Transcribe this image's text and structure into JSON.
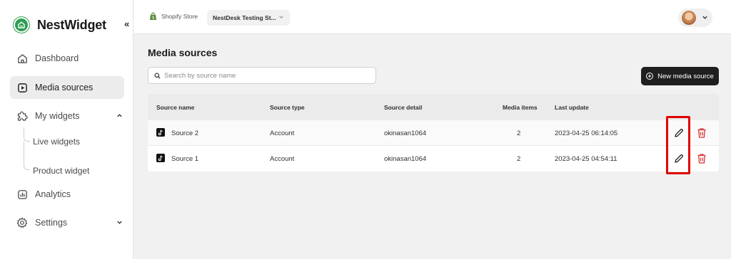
{
  "brand": {
    "name": "NestWidget"
  },
  "sidebar": {
    "collapse_label": "«",
    "items": [
      {
        "label": "Dashboard",
        "icon": "home-icon"
      },
      {
        "label": "Media sources",
        "icon": "media-icon",
        "active": true
      },
      {
        "label": "My widgets",
        "icon": "puzzle-icon",
        "expanded": true
      },
      {
        "label": "Analytics",
        "icon": "chart-icon"
      },
      {
        "label": "Settings",
        "icon": "gear-icon"
      }
    ],
    "sub_items": [
      {
        "label": "Live widgets"
      },
      {
        "label": "Product widget"
      }
    ]
  },
  "topbar": {
    "store_label": "Shopify Store",
    "store_value": "NestDesk Testing St..."
  },
  "page": {
    "title": "Media sources",
    "search_placeholder": "Search by source name",
    "new_button": "New media source"
  },
  "table": {
    "headers": [
      "Source name",
      "Source type",
      "Source detail",
      "Media items",
      "Last update"
    ],
    "rows": [
      {
        "name": "Source 2",
        "type": "Account",
        "detail": "okinasan1064",
        "items": "2",
        "updated": "2023-04-25 06:14:05"
      },
      {
        "name": "Source 1",
        "type": "Account",
        "detail": "okinasan1064",
        "items": "2",
        "updated": "2023-04-25 04:54:11"
      }
    ]
  },
  "colors": {
    "brand_green": "#2e9e52",
    "primary_button": "#1f1f1f",
    "delete_red": "#d93030",
    "highlight_red": "#e00000"
  }
}
